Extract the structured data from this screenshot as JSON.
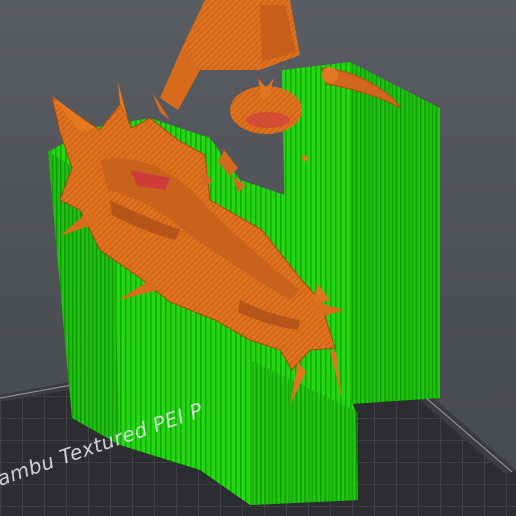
{
  "build_plate": {
    "label": "ambu Textured PEI P",
    "color": "#2c2e31",
    "grid_color": "#55585d"
  },
  "model": {
    "support_color": "#22dd10",
    "support_shade": "#159a08",
    "surface_color": "#e2731f",
    "surface_shade": "#b4541a",
    "highlight_color": "#cf3a3a"
  }
}
